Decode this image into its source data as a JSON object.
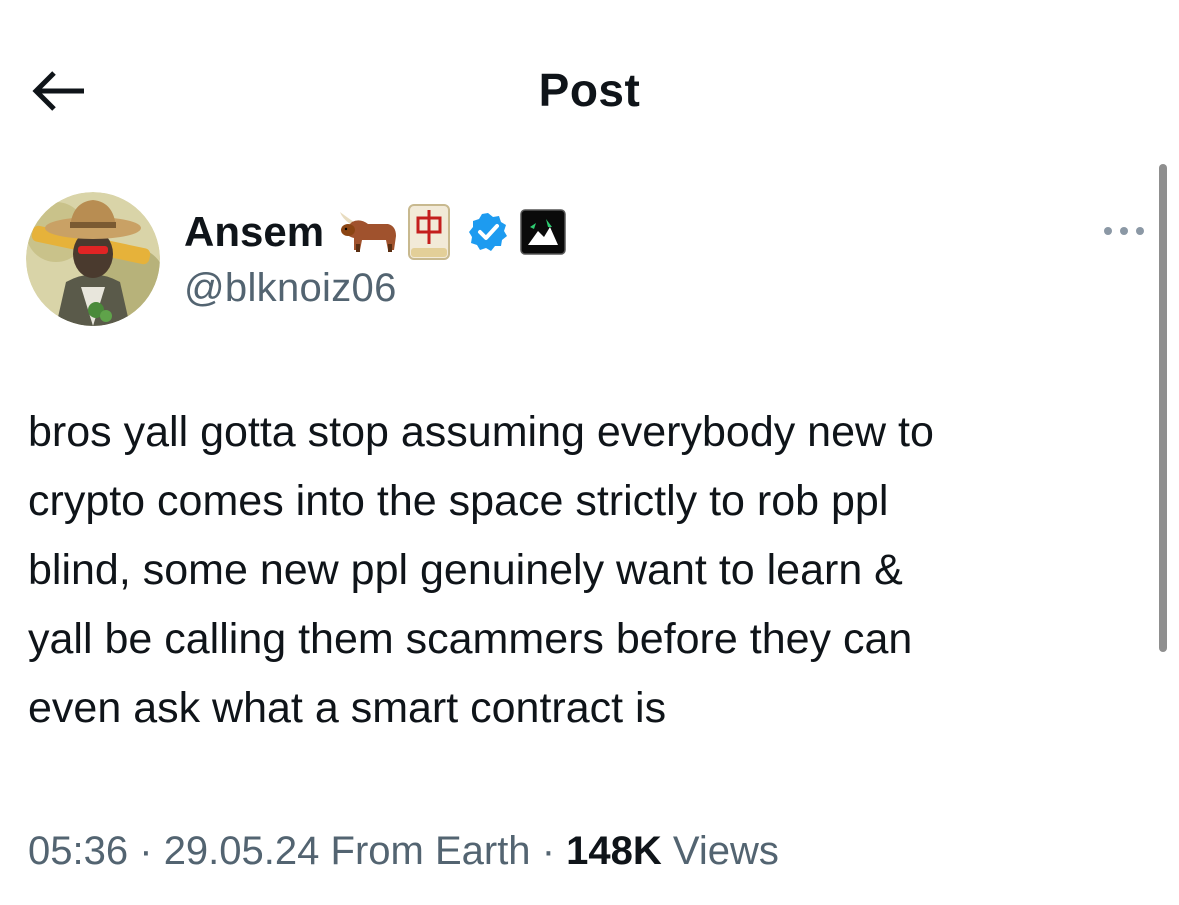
{
  "header": {
    "title": "Post",
    "back_icon": "arrow-left-icon"
  },
  "author": {
    "name": "Ansem",
    "handle": "@blknoiz06",
    "badges": [
      "ox-emoji",
      "mahjong-red-dragon-emoji",
      "verified-badge-icon",
      "affiliate-badge-icon"
    ],
    "verified_color": "#1d9bf0"
  },
  "more_icon": "more-horizontal-icon",
  "tweet": {
    "lines": [
      "bros yall gotta stop assuming everybody new to",
      "crypto comes into the space strictly to rob ppl",
      "blind, some new ppl genuinely want to learn &",
      "yall be calling them scammers before they can",
      "even ask what a smart contract is"
    ]
  },
  "meta": {
    "time": "05:36",
    "separator": "·",
    "date": "29.05.24",
    "location": "From Earth",
    "views_count": "148K",
    "views_label": "Views"
  },
  "colors": {
    "text_primary": "#0f1419",
    "text_secondary": "#536471",
    "accent": "#1d9bf0"
  }
}
